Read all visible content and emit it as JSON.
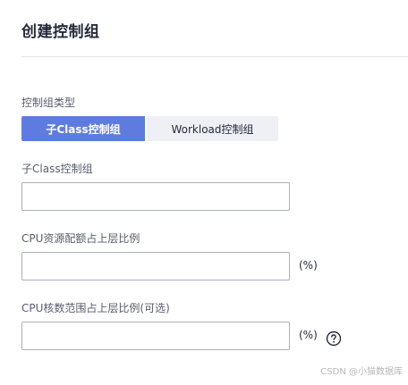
{
  "dialog": {
    "title": "创建控制组"
  },
  "group_type": {
    "label": "控制组类型",
    "options": [
      {
        "label": "子Class控制组",
        "selected": true
      },
      {
        "label": "Workload控制组",
        "selected": false
      }
    ]
  },
  "subclass_name": {
    "label": "子Class控制组",
    "value": "",
    "placeholder": ""
  },
  "cpu_share": {
    "label": "CPU资源配额占上层比例",
    "value": "",
    "placeholder": "",
    "unit": "(%)"
  },
  "cpu_core_range": {
    "label": "CPU核数范围占上层比例(可选)",
    "value": "",
    "placeholder": "",
    "unit": "(%)",
    "help_icon": "question-circle-icon"
  },
  "watermark": "CSDN @小猫数据库",
  "colors": {
    "accent": "#5e7ce0",
    "inactive_segment": "#eef0f5",
    "border": "#adb0b8",
    "divider": "#e3e5ea"
  }
}
